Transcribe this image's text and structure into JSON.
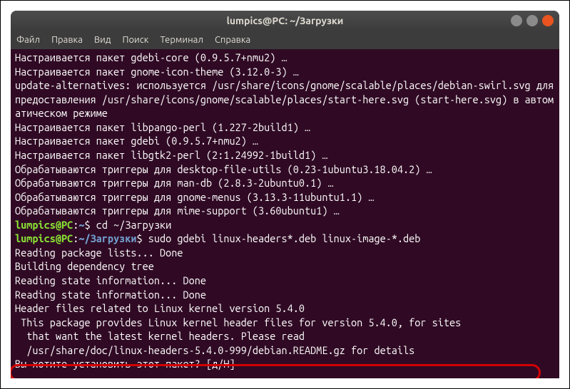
{
  "window": {
    "title": "lumpics@PC: ~/Загрузки"
  },
  "menubar": {
    "items": [
      "Файл",
      "Правка",
      "Вид",
      "Поиск",
      "Терминал",
      "Справка"
    ]
  },
  "prompt": {
    "user_host": "lumpics@PC",
    "separator": ":",
    "path": "~",
    "path2": "~/Загрузки",
    "dollar": "$"
  },
  "terminal": {
    "lines": [
      "Настраивается пакет gdebi-core (0.9.5.7+nmu2) …",
      "Настраивается пакет gnome-icon-theme (3.12.0-3) …",
      "update-alternatives: используется /usr/share/icons/gnome/scalable/places/debian-swirl.svg для предоставления /usr/share/icons/gnome/scalable/places/start-here.svg (start-here.svg) в автоматическом режиме",
      "Настраивается пакет libpango-perl (1.227-2build1) …",
      "Настраивается пакет gdebi (0.9.5.7+nmu2) …",
      "Настраивается пакет libgtk2-perl (2:1.24992-1build1) …",
      "Обрабатываются триггеры для desktop-file-utils (0.23-1ubuntu3.18.04.2) …",
      "Обрабатываются триггеры для man-db (2.8.3-2ubuntu0.1) …",
      "Обрабатываются триггеры для gnome-menus (3.13.3-11ubuntu1.1) …",
      "Обрабатываются триггеры для mime-support (3.60ubuntu1) …"
    ],
    "cmd1": " cd ~/Загрузки",
    "cmd2": " sudo gdebi linux-headers*.deb linux-image-*.deb",
    "lines2": [
      "Reading package lists... Done",
      "Building dependency tree",
      "Reading state information... Done",
      "Reading state information... Done",
      "",
      "Header files related to Linux kernel version 5.4.0",
      " This package provides Linux kernel header files for version 5.4.0, for sites",
      "  that want the latest kernel headers. Please read",
      "  /usr/share/doc/linux-headers-5.4.0-999/debian.README.gz for details"
    ],
    "prompt_line": "Вы хотите установить этот пакет? [д/Н]"
  }
}
